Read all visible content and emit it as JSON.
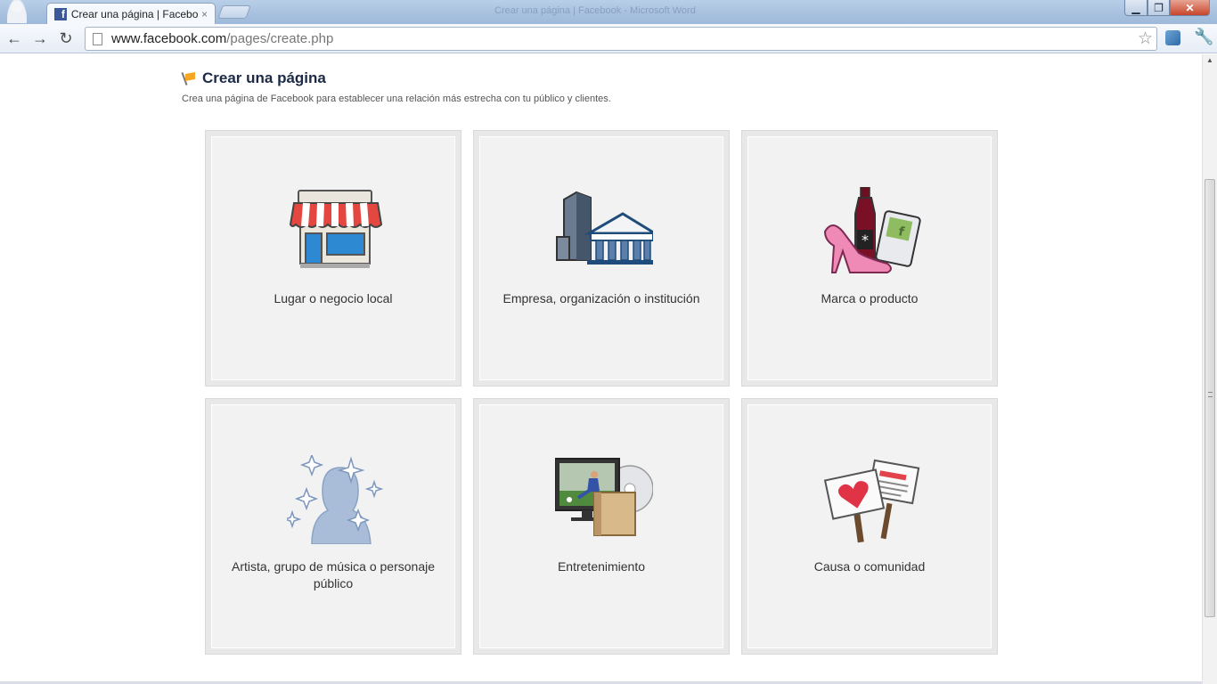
{
  "browser": {
    "tab_title": "Crear una página | Facebook",
    "tab_close": "×",
    "window_title": "Crear una página | Facebook - Microsoft Word",
    "url_host": "www.facebook.com",
    "url_path": "/pages/create.php",
    "icons": {
      "back": "arrow-left-icon",
      "forward": "arrow-right-icon",
      "reload": "reload-icon",
      "bookmark": "star-icon",
      "menu": "wrench-icon"
    }
  },
  "page": {
    "title": "Crear una página",
    "subtitle": "Crea una página de Facebook para establecer una relación más estrecha con tu público y clientes.",
    "categories": [
      {
        "label": "Lugar o negocio local",
        "icon": "storefront-icon"
      },
      {
        "label": "Empresa, organización o institución",
        "icon": "buildings-icon"
      },
      {
        "label": "Marca o producto",
        "icon": "products-icon"
      },
      {
        "label": "Artista, grupo de música o personaje público",
        "icon": "person-silhouette-icon"
      },
      {
        "label": "Entretenimiento",
        "icon": "tv-media-icon"
      },
      {
        "label": "Causa o comunidad",
        "icon": "protest-signs-icon"
      }
    ]
  },
  "colors": {
    "facebook_blue": "#3b5998",
    "title_color": "#1c2a47",
    "card_bg": "#f2f2f2"
  }
}
